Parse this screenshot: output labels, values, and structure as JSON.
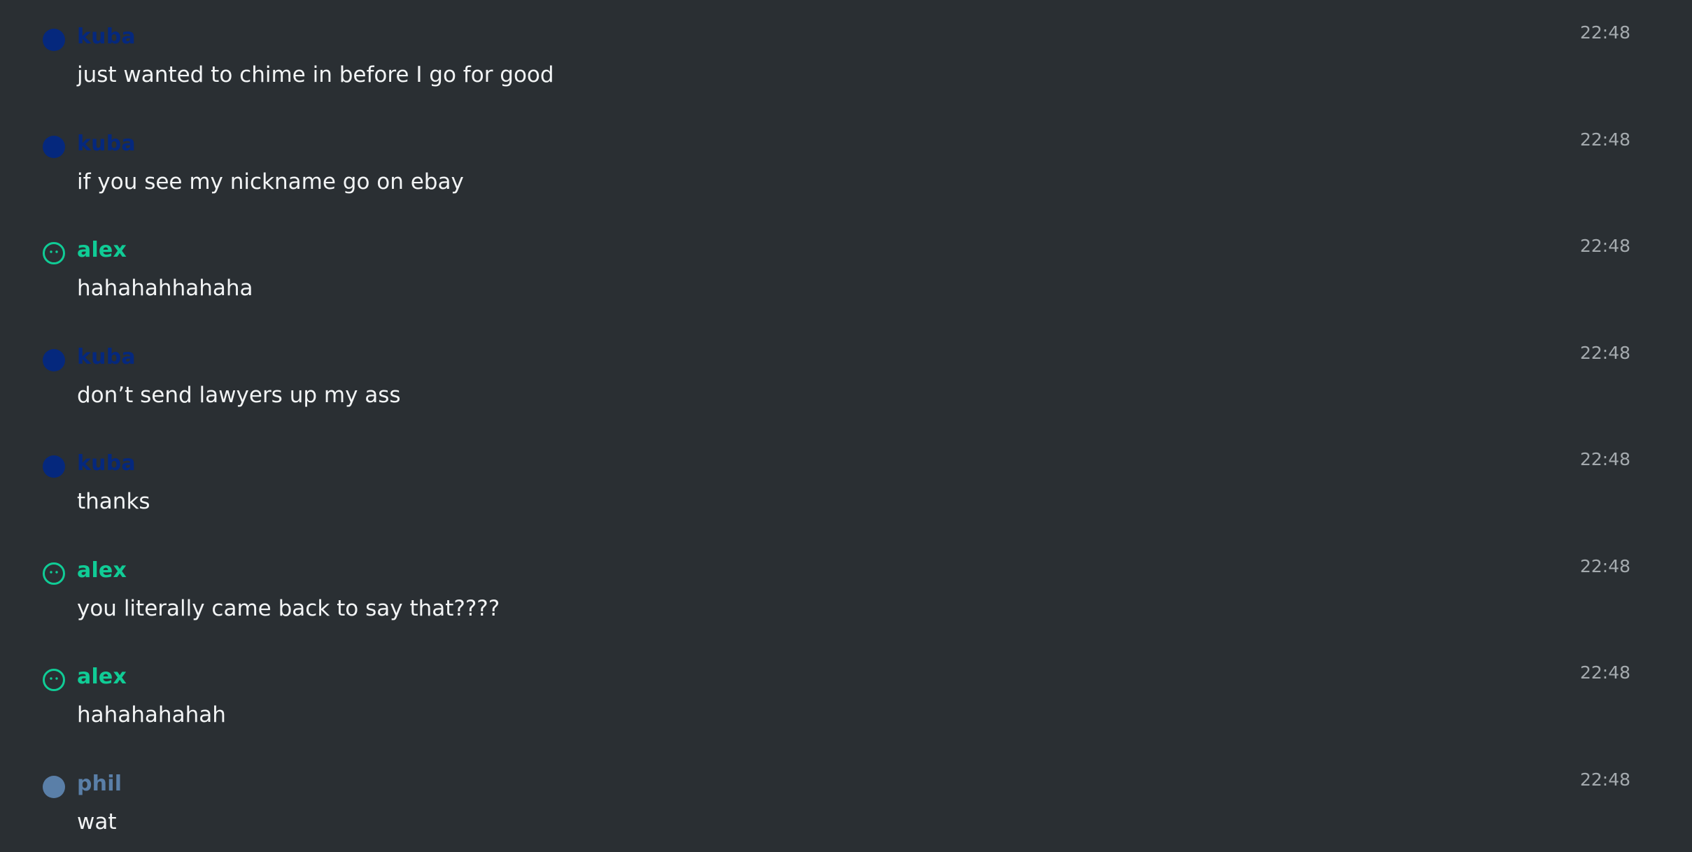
{
  "messages": [
    {
      "user": "kuba",
      "style": "solid",
      "color": "#05287d",
      "text": "just wanted to chime in before I go for good",
      "time": "22:48"
    },
    {
      "user": "kuba",
      "style": "solid",
      "color": "#05287d",
      "text": "if you see my nickname go on ebay",
      "time": "22:48"
    },
    {
      "user": "alex",
      "style": "ring",
      "color": "#10cc96",
      "text": "hahahahhahaha",
      "time": "22:48"
    },
    {
      "user": "kuba",
      "style": "solid",
      "color": "#05287d",
      "text": "don’t send lawyers up my ass",
      "time": "22:48"
    },
    {
      "user": "kuba",
      "style": "solid",
      "color": "#05287d",
      "text": "thanks",
      "time": "22:48"
    },
    {
      "user": "alex",
      "style": "ring",
      "color": "#10cc96",
      "text": "you literally came back to say that????",
      "time": "22:48"
    },
    {
      "user": "alex",
      "style": "ring",
      "color": "#10cc96",
      "text": "hahahahahah",
      "time": "22:48"
    },
    {
      "user": "phil",
      "style": "solid",
      "color": "#5a7fa8",
      "text": "wat",
      "time": "22:48"
    }
  ],
  "colors": {
    "background": "#2a2f33",
    "message_text": "#f2f4f5",
    "timestamp": "#a4aaae"
  },
  "icons": {
    "solid_avatar": "avatar-solid-circle",
    "ring_avatar": "avatar-smiley-ring"
  }
}
